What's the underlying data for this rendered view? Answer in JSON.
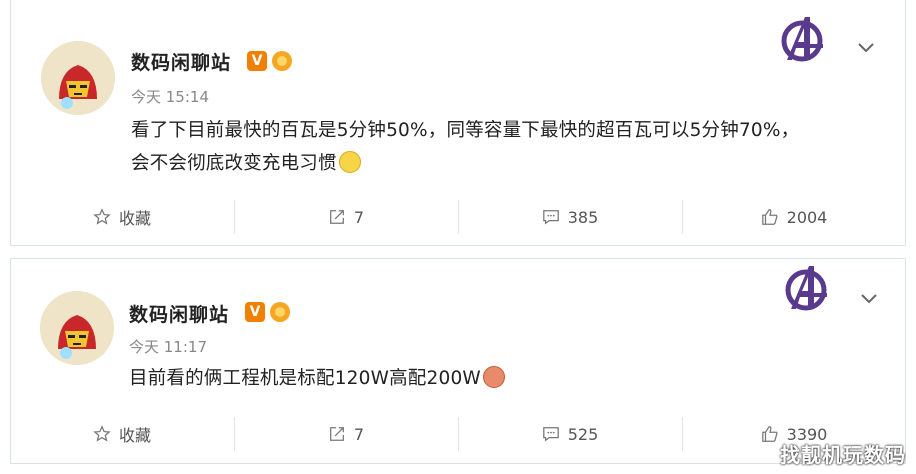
{
  "posts": [
    {
      "username": "数码闲聊站",
      "badge_v": "V",
      "time": "今天 15:14",
      "content_line1": "看了下目前最快的百瓦是5分钟50%，同等容量下最快的超百瓦可以5分钟70%，",
      "content_line2": "会不会彻底改变充电习惯",
      "actions": {
        "favorite": "收藏",
        "repost": "7",
        "comment": "385",
        "like": "2004"
      }
    },
    {
      "username": "数码闲聊站",
      "badge_v": "V",
      "time": "今天 11:17",
      "content_line1": "目前看的俩工程机是标配120W高配200W",
      "actions": {
        "favorite": "收藏",
        "repost": "7",
        "comment": "525",
        "like": "3390"
      }
    }
  ],
  "watermark": "找靓机玩数码",
  "colors": {
    "vbadge": "#f18000",
    "avengers": "#5a3a8c",
    "border": "#d6e3ee"
  },
  "icons": [
    "avatar-ironman",
    "avengers-logo-icon",
    "chevron-down-icon",
    "star-icon",
    "repost-icon",
    "comment-icon",
    "thumbs-up-icon",
    "emoji-smile-icon",
    "emoji-laugh-icon"
  ]
}
